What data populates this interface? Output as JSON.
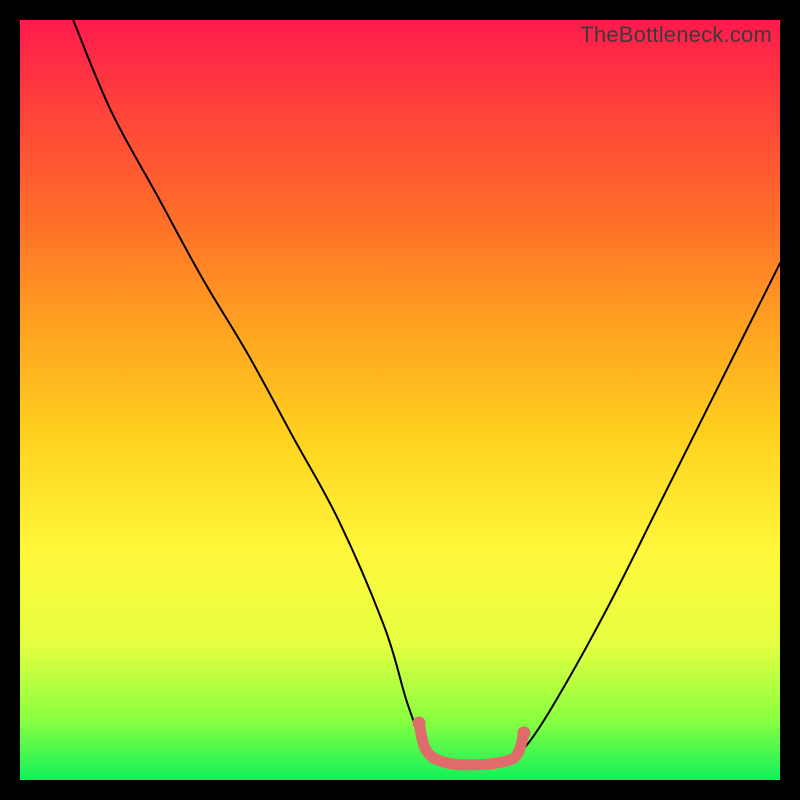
{
  "watermark": "TheBottleneck.com",
  "chart_data": {
    "type": "line",
    "title": "",
    "xlabel": "",
    "ylabel": "",
    "xlim": [
      0,
      100
    ],
    "ylim": [
      0,
      100
    ],
    "grid": false,
    "legend_position": "none",
    "series": [
      {
        "name": "main-curve",
        "color": "#000000",
        "x": [
          7,
          12,
          18,
          24,
          30,
          36,
          42,
          48,
          51,
          53.5,
          56,
          58,
          60,
          62,
          64,
          67,
          72,
          78,
          84,
          90,
          96,
          100
        ],
        "y": [
          100,
          88,
          77,
          66,
          56,
          45,
          34,
          20,
          10,
          4,
          2.3,
          2.0,
          2.0,
          2.1,
          2.6,
          5,
          13,
          24,
          36,
          48,
          60,
          68
        ]
      },
      {
        "name": "flat-bottom-highlight",
        "color": "#e06b6b",
        "x": [
          52.5,
          53.5,
          56,
          60,
          64,
          65.5,
          66.3
        ],
        "y": [
          7.5,
          3.8,
          2.3,
          2.0,
          2.5,
          3.5,
          6.2
        ]
      }
    ],
    "highlight_endpoints": {
      "left": {
        "x": 52.5,
        "y": 7.5
      },
      "right": {
        "x": 66.3,
        "y": 6.2
      }
    },
    "background_gradient_stops": [
      {
        "pos": 0.0,
        "color": "#ff1a4d"
      },
      {
        "pos": 0.1,
        "color": "#ff3d3d"
      },
      {
        "pos": 0.25,
        "color": "#ff6a2a"
      },
      {
        "pos": 0.4,
        "color": "#ffa020"
      },
      {
        "pos": 0.55,
        "color": "#ffd21f"
      },
      {
        "pos": 0.7,
        "color": "#fff73b"
      },
      {
        "pos": 0.82,
        "color": "#e6ff40"
      },
      {
        "pos": 0.92,
        "color": "#8aff40"
      },
      {
        "pos": 1.0,
        "color": "#12f15a"
      }
    ]
  }
}
